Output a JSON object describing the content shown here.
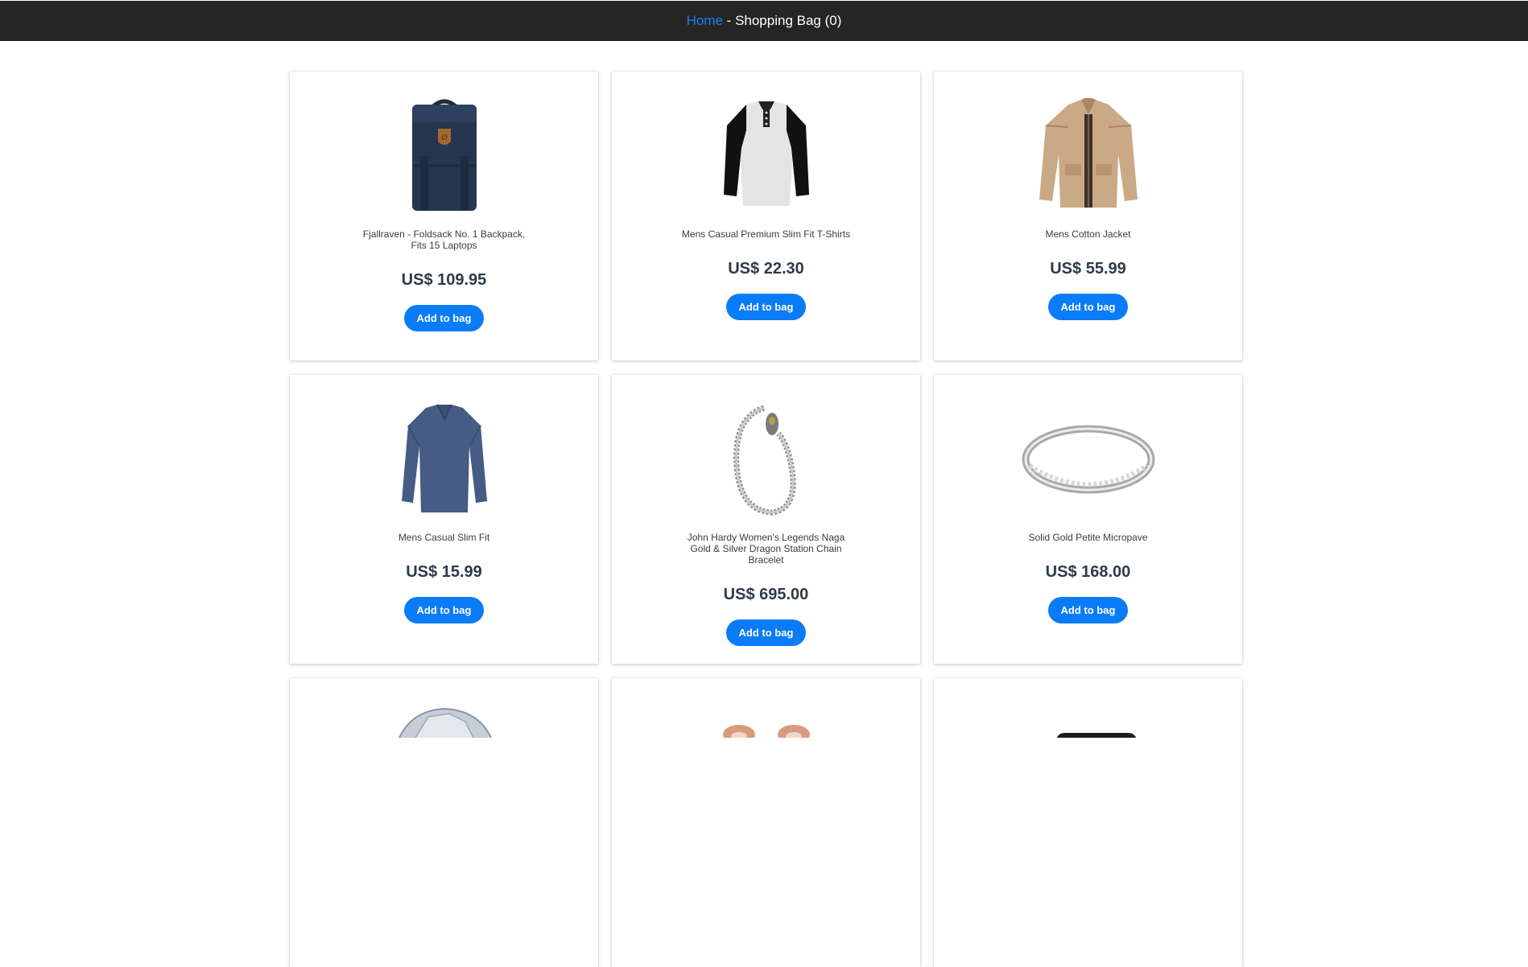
{
  "nav": {
    "home_label": "Home",
    "separator": " - ",
    "bag_label": "Shopping Bag (0)"
  },
  "products": [
    {
      "name": "Fjallraven - Foldsack No. 1 Backpack, Fits 15 Laptops",
      "price": "US$ 109.95",
      "button": "Add to bag",
      "icon": "backpack-image"
    },
    {
      "name": "Mens Casual Premium Slim Fit T-Shirts",
      "price": "US$ 22.30",
      "button": "Add to bag",
      "icon": "tshirt-image"
    },
    {
      "name": "Mens Cotton Jacket",
      "price": "US$ 55.99",
      "button": "Add to bag",
      "icon": "jacket-image"
    },
    {
      "name": "Mens Casual Slim Fit",
      "price": "US$ 15.99",
      "button": "Add to bag",
      "icon": "longsleeve-image"
    },
    {
      "name": "John Hardy Women's Legends Naga Gold & Silver Dragon Station Chain Bracelet",
      "price": "US$ 695.00",
      "button": "Add to bag",
      "icon": "bracelet-image"
    },
    {
      "name": "Solid Gold Petite Micropave",
      "price": "US$ 168.00",
      "button": "Add to bag",
      "icon": "ring-image"
    }
  ],
  "partial_products": [
    {
      "icon": "diamond-ring-image"
    },
    {
      "icon": "earrings-image"
    },
    {
      "icon": "hard-drive-image"
    }
  ],
  "colors": {
    "topbar": "#252525",
    "link": "#1f7ef2",
    "button": "#0a7cf7",
    "price": "#2c3a4a"
  }
}
